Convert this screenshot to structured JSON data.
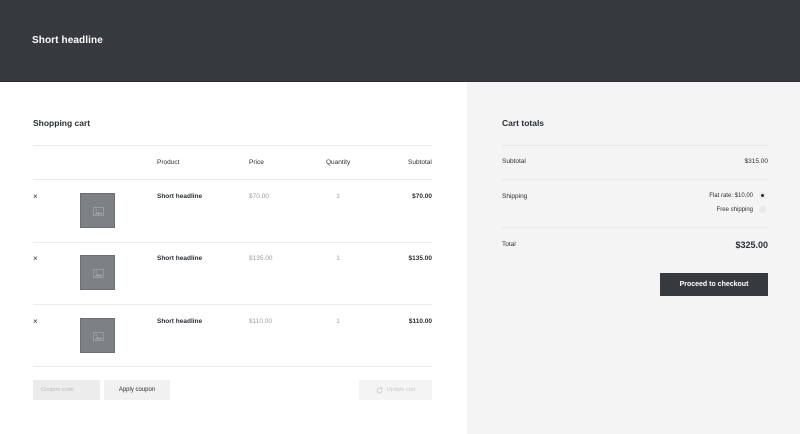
{
  "header": {
    "title": "Short headline"
  },
  "cart": {
    "title": "Shopping cart",
    "columns": {
      "product": "Product",
      "price": "Price",
      "quantity": "Quantity",
      "subtotal": "Subtotal"
    },
    "items": [
      {
        "remove": "×",
        "image_icon": "image-placeholder-icon",
        "name": "Short headline",
        "price": "$70.00",
        "quantity": "1",
        "subtotal": "$70.00"
      },
      {
        "remove": "×",
        "image_icon": "image-placeholder-icon",
        "name": "Short headline",
        "price": "$135.00",
        "quantity": "1",
        "subtotal": "$135.00"
      },
      {
        "remove": "×",
        "image_icon": "image-placeholder-icon",
        "name": "Short headline",
        "price": "$110.00",
        "quantity": "1",
        "subtotal": "$110.00"
      }
    ],
    "coupon": {
      "placeholder": "Coupon code",
      "apply_label": "Apply coupon"
    },
    "update_label": "Update cart"
  },
  "totals": {
    "title": "Cart totals",
    "subtotal_label": "Subtotal",
    "subtotal_value": "$315.00",
    "shipping_label": "Shipping",
    "shipping_options": [
      {
        "label": "Flat rate: $10.00",
        "selected": true
      },
      {
        "label": "Free shipping",
        "selected": false
      }
    ],
    "total_label": "Total",
    "total_value": "$325.00",
    "checkout_label": "Proceed to checkout"
  },
  "colors": {
    "header_bg": "#363a3f",
    "sidebar_bg": "#f4f4f4",
    "thumb_bg": "#7d8084",
    "button_dark": "#363a3f"
  }
}
